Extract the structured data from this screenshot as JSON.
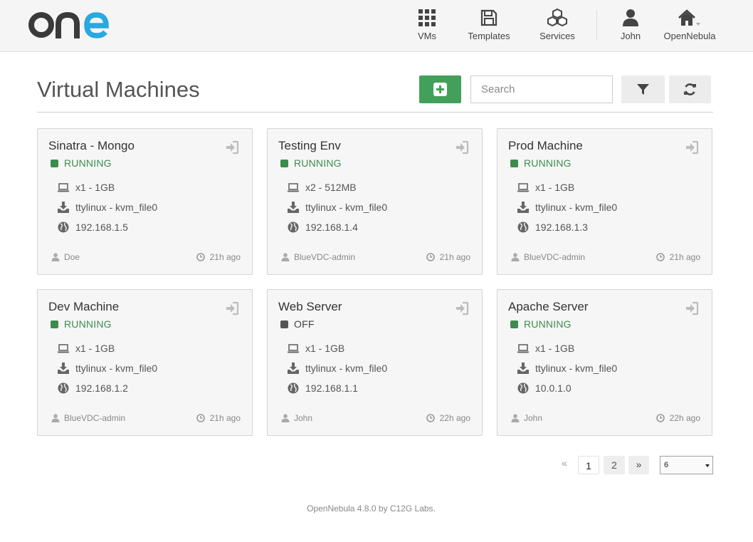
{
  "app": {
    "logo_text": "one"
  },
  "nav": {
    "vms": "VMs",
    "templates": "Templates",
    "services": "Services",
    "user": "John",
    "zone": "OpenNebula"
  },
  "page": {
    "title": "Virtual Machines",
    "search_placeholder": "Search"
  },
  "colors": {
    "running": "#3c8c4e",
    "off": "#555555",
    "accent_green": "#43a05a"
  },
  "vms": [
    {
      "name": "Sinatra - Mongo",
      "state": "RUNNING",
      "capacity": "x1 - 1GB",
      "disk": "ttylinux - kvm_file0",
      "ip": "192.168.1.5",
      "owner": "Doe",
      "age": "21h ago"
    },
    {
      "name": "Testing Env",
      "state": "RUNNING",
      "capacity": "x2 - 512MB",
      "disk": "ttylinux - kvm_file0",
      "ip": "192.168.1.4",
      "owner": "BlueVDC-admin",
      "age": "21h ago"
    },
    {
      "name": "Prod Machine",
      "state": "RUNNING",
      "capacity": "x1 - 1GB",
      "disk": "ttylinux - kvm_file0",
      "ip": "192.168.1.3",
      "owner": "BlueVDC-admin",
      "age": "21h ago"
    },
    {
      "name": "Dev Machine",
      "state": "RUNNING",
      "capacity": "x1 - 1GB",
      "disk": "ttylinux - kvm_file0",
      "ip": "192.168.1.2",
      "owner": "BlueVDC-admin",
      "age": "21h ago"
    },
    {
      "name": "Web Server",
      "state": "OFF",
      "capacity": "x1 - 1GB",
      "disk": "ttylinux - kvm_file0",
      "ip": "192.168.1.1",
      "owner": "John",
      "age": "22h ago"
    },
    {
      "name": "Apache Server",
      "state": "RUNNING",
      "capacity": "x1 - 1GB",
      "disk": "ttylinux - kvm_file0",
      "ip": "10.0.1.0",
      "owner": "John",
      "age": "22h ago"
    }
  ],
  "pagination": {
    "prev": "«",
    "pages": [
      "1",
      "2"
    ],
    "current": "1",
    "next": "»",
    "page_size": "6"
  },
  "footer": "OpenNebula 4.8.0 by C12G Labs."
}
